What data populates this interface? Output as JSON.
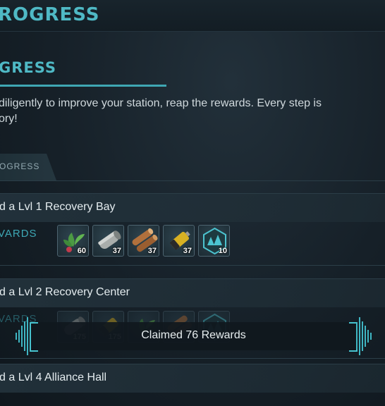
{
  "header": {
    "title": "ROGRESS"
  },
  "section": {
    "heading": "GRESS",
    "description_line1": "diligently to improve your station, reap the rewards. Every step is",
    "description_line2": "ory!"
  },
  "tab": {
    "label": "OGRESS"
  },
  "rows": [
    {
      "title": "d a Lvl 1 Recovery Bay",
      "rewards_label": "VARDS",
      "rewards": [
        {
          "icon": "herb-icon",
          "qty": "60"
        },
        {
          "icon": "metal-ingot-icon",
          "qty": "37"
        },
        {
          "icon": "wood-logs-icon",
          "qty": "37"
        },
        {
          "icon": "battery-icon",
          "qty": "37"
        },
        {
          "icon": "trees-badge-icon",
          "qty": "10"
        }
      ]
    },
    {
      "title": "d a Lvl 2 Recovery Center",
      "rewards_label": "VARDS",
      "rewards": [
        {
          "icon": "metal-ingot-icon",
          "qty": "175"
        },
        {
          "icon": "battery-icon",
          "qty": "175"
        },
        {
          "icon": "herb-icon",
          "qty": ""
        },
        {
          "icon": "wood-logs-icon",
          "qty": ""
        },
        {
          "icon": "trees-badge-icon",
          "qty": ""
        }
      ]
    },
    {
      "title": "d a Lvl 4 Alliance Hall"
    }
  ],
  "toast": {
    "text": "Claimed 76 Rewards"
  },
  "colors": {
    "accent": "#4fb9c5",
    "background": "#162028",
    "text": "#dfe7ea"
  }
}
